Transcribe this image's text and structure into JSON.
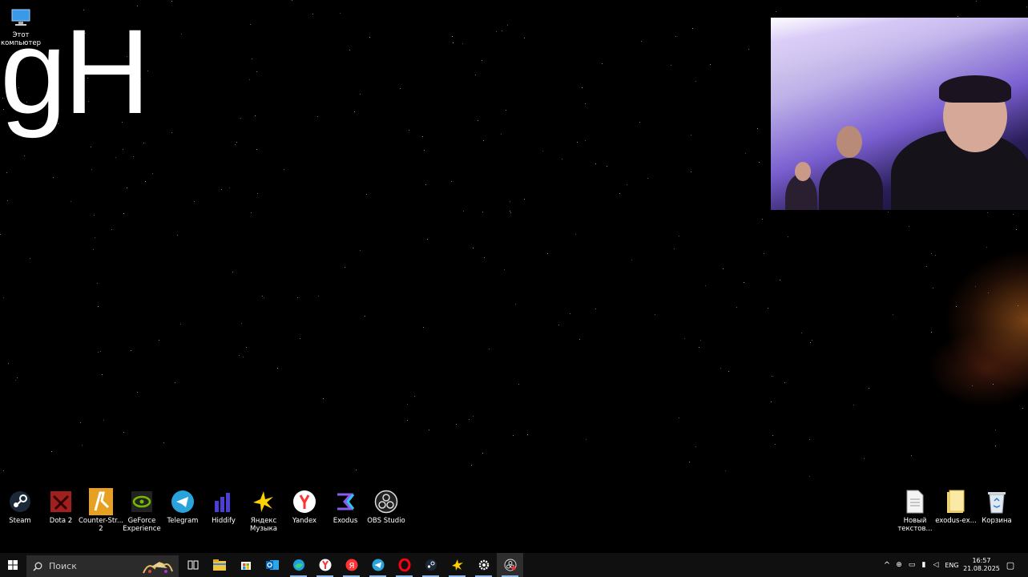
{
  "desktop": {
    "top_left_icon": {
      "label_line1": "Этот",
      "label_line2": "компьютер",
      "icon": "computer-icon"
    },
    "overlay_text": "gH",
    "shortcuts": [
      {
        "label": "Steam",
        "icon": "steam-icon"
      },
      {
        "label": "Dota 2",
        "icon": "dota2-icon"
      },
      {
        "label": "Counter-Str... 2",
        "icon": "counter-strike-icon"
      },
      {
        "label": "GeForce Experience",
        "icon": "geforce-icon"
      },
      {
        "label": "Telegram",
        "icon": "telegram-icon"
      },
      {
        "label": "Hiddify",
        "icon": "hiddify-icon"
      },
      {
        "label": "Яндекс Музыка",
        "icon": "yandex-music-icon"
      },
      {
        "label": "Yandex",
        "icon": "yandex-browser-icon"
      },
      {
        "label": "Exodus",
        "icon": "exodus-icon"
      },
      {
        "label": "OBS Studio",
        "icon": "obs-icon"
      }
    ],
    "right_icons": [
      {
        "label": "Новый текстов...",
        "icon": "text-file-icon"
      },
      {
        "label": "exodus-ex...",
        "icon": "folder-icon"
      },
      {
        "label": "Корзина",
        "icon": "recycle-bin-icon"
      }
    ]
  },
  "taskbar": {
    "search_placeholder": "Поиск",
    "pinned": [
      "task-view-icon",
      "file-explorer-icon",
      "store-icon",
      "outlook-icon",
      "edge-icon",
      "yandex-browser-icon",
      "yandex-icon",
      "telegram-icon",
      "opera-icon",
      "steam-icon",
      "yandex-music-icon",
      "settings-icon",
      "obs-icon"
    ],
    "tray": {
      "language": "ENG",
      "time": "16:57",
      "date": "21.08.2025"
    }
  },
  "colors": {
    "taskbar": "#101010",
    "search": "#2b2b2b",
    "accent": "#8fb8e8"
  }
}
